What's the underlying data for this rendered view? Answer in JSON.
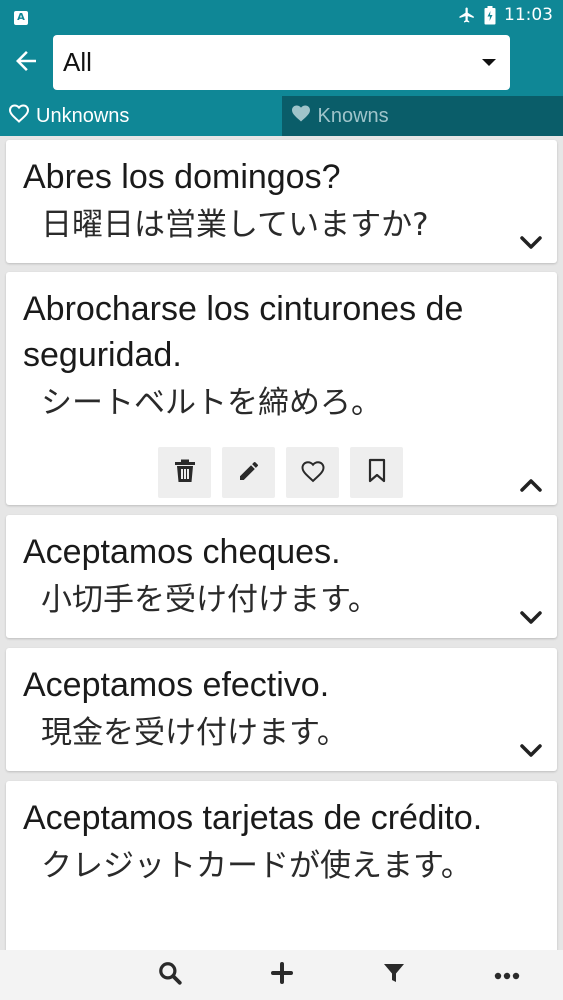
{
  "status_bar": {
    "app_badge": "A",
    "time": "11:03",
    "icons": [
      "airplane-mode-icon",
      "battery-icon"
    ]
  },
  "header": {
    "back_icon": "arrow-left-icon",
    "dropdown_value": "All"
  },
  "tabs": [
    {
      "label": "Unknowns",
      "icon": "heart-outline-icon",
      "active": true
    },
    {
      "label": "Knowns",
      "icon": "heart-filled-icon",
      "active": false
    }
  ],
  "cards": [
    {
      "term": "Abres los domingos?",
      "translation": "日曜日は営業していますか?",
      "expanded": false
    },
    {
      "term": "Abrocharse los cinturones de seguridad.",
      "translation": "シートベルトを締めろ。",
      "expanded": true
    },
    {
      "term": "Aceptamos cheques.",
      "translation": "小切手を受け付けます。",
      "expanded": false
    },
    {
      "term": "Aceptamos efectivo.",
      "translation": "現金を受け付けます。",
      "expanded": false
    },
    {
      "term": "Aceptamos tarjetas de crédito.",
      "translation": "クレジットカードが使えます。",
      "expanded": false
    }
  ],
  "card_actions": [
    "trash-icon",
    "pencil-icon",
    "heart-outline-icon",
    "bookmark-icon"
  ],
  "bottom_bar": [
    "search-icon",
    "plus-icon",
    "filter-icon",
    "more-icon"
  ],
  "colors": {
    "primary": "#0f8796",
    "tab_inactive": "#0a5d69",
    "background": "#e6e6e6"
  }
}
